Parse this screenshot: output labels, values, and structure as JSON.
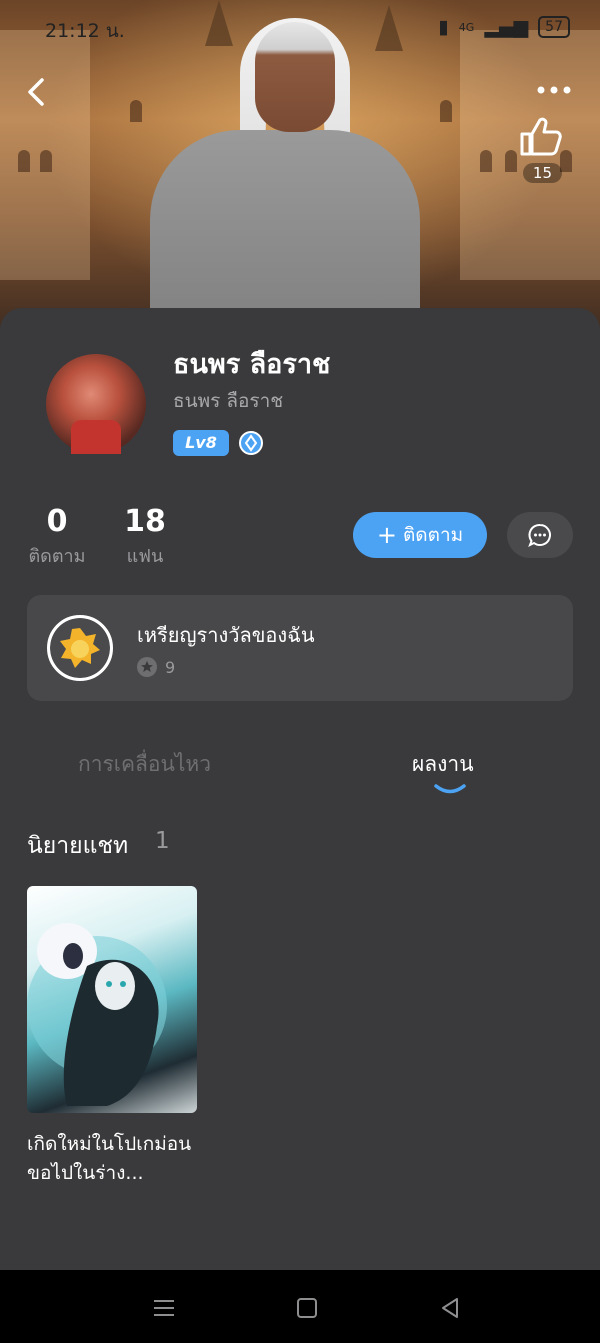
{
  "status_bar": {
    "time": "21:12 น.",
    "network": "4G",
    "battery": "57"
  },
  "header": {
    "like_count": "15"
  },
  "profile": {
    "name": "ธนพร ลือราช",
    "username": "ธนพร ลือราช",
    "level": "Lv8",
    "following_count": "0",
    "following_label": "ติดตาม",
    "fans_count": "18",
    "fans_label": "แฟน",
    "follow_button": "ติดตาม"
  },
  "medals": {
    "title": "เหรียญรางวัลของฉัน",
    "count": "9"
  },
  "tabs": {
    "activity": "การเคลื่อนไหว",
    "works": "ผลงาน",
    "active": "works"
  },
  "section": {
    "title": "นิยายแชท",
    "count": "1"
  },
  "works": [
    {
      "title": "เกิดใหม่ในโปเกม่อนขอไปในร่าง..."
    }
  ],
  "colors": {
    "accent": "#4da3f3",
    "background": "#3a3a3c",
    "card": "#48484a"
  }
}
